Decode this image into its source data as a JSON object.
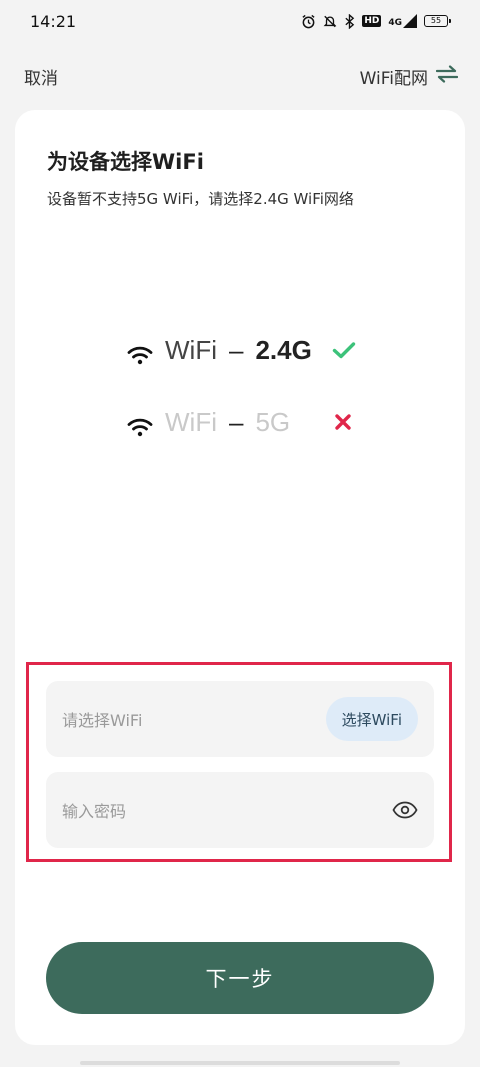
{
  "status_bar": {
    "time": "14:21",
    "network_label": "4G",
    "hd_label": "HD",
    "battery_level": "55",
    "icons": [
      "alarm-icon",
      "mute-bell-icon",
      "bluetooth-icon",
      "hd-icon",
      "signal-icon",
      "battery-icon"
    ]
  },
  "nav": {
    "cancel_label": "取消",
    "right_label": "WiFi配网",
    "right_icon": "swap-arrows-icon"
  },
  "card": {
    "title": "为设备选择WiFi",
    "subtitle": "设备暂不支持5G WiFi，请选择2.4G WiFi网络"
  },
  "bands": [
    {
      "name": "WiFi",
      "dash": "–",
      "value": "2.4G",
      "supported": true,
      "icon": "check-icon"
    },
    {
      "name": "WiFi",
      "dash": "–",
      "value": "5G",
      "supported": false,
      "icon": "cross-icon"
    }
  ],
  "form": {
    "wifi_placeholder": "请选择WiFi",
    "select_wifi_label": "选择WiFi",
    "password_placeholder": "输入密码"
  },
  "next_button_label": "下一步",
  "colors": {
    "primary": "#3d6b5c",
    "check": "#3cc27a",
    "cross": "#e0264a",
    "highlight": "#e0264a",
    "chip_bg": "#deebf8"
  }
}
